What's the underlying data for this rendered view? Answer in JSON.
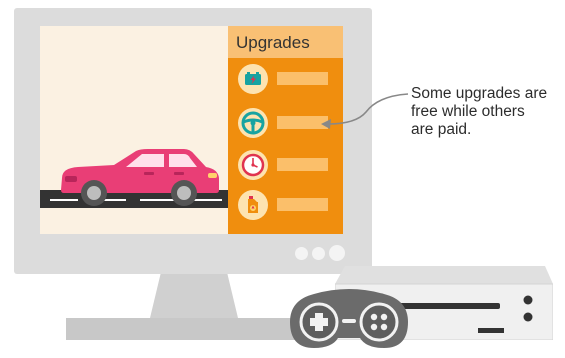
{
  "panel": {
    "title": "Upgrades",
    "items": [
      {
        "icon": "battery-icon"
      },
      {
        "icon": "steering-wheel-icon"
      },
      {
        "icon": "speedometer-icon"
      },
      {
        "icon": "fuel-canister-icon"
      }
    ]
  },
  "annotation": {
    "text_lines": [
      "Some upgrades are",
      "free while others",
      "are paid."
    ]
  },
  "colors": {
    "panel": "#f08e0e",
    "panel_header": "#f9c074",
    "car": "#e93e76",
    "icon_teal": "#17a3a1"
  }
}
